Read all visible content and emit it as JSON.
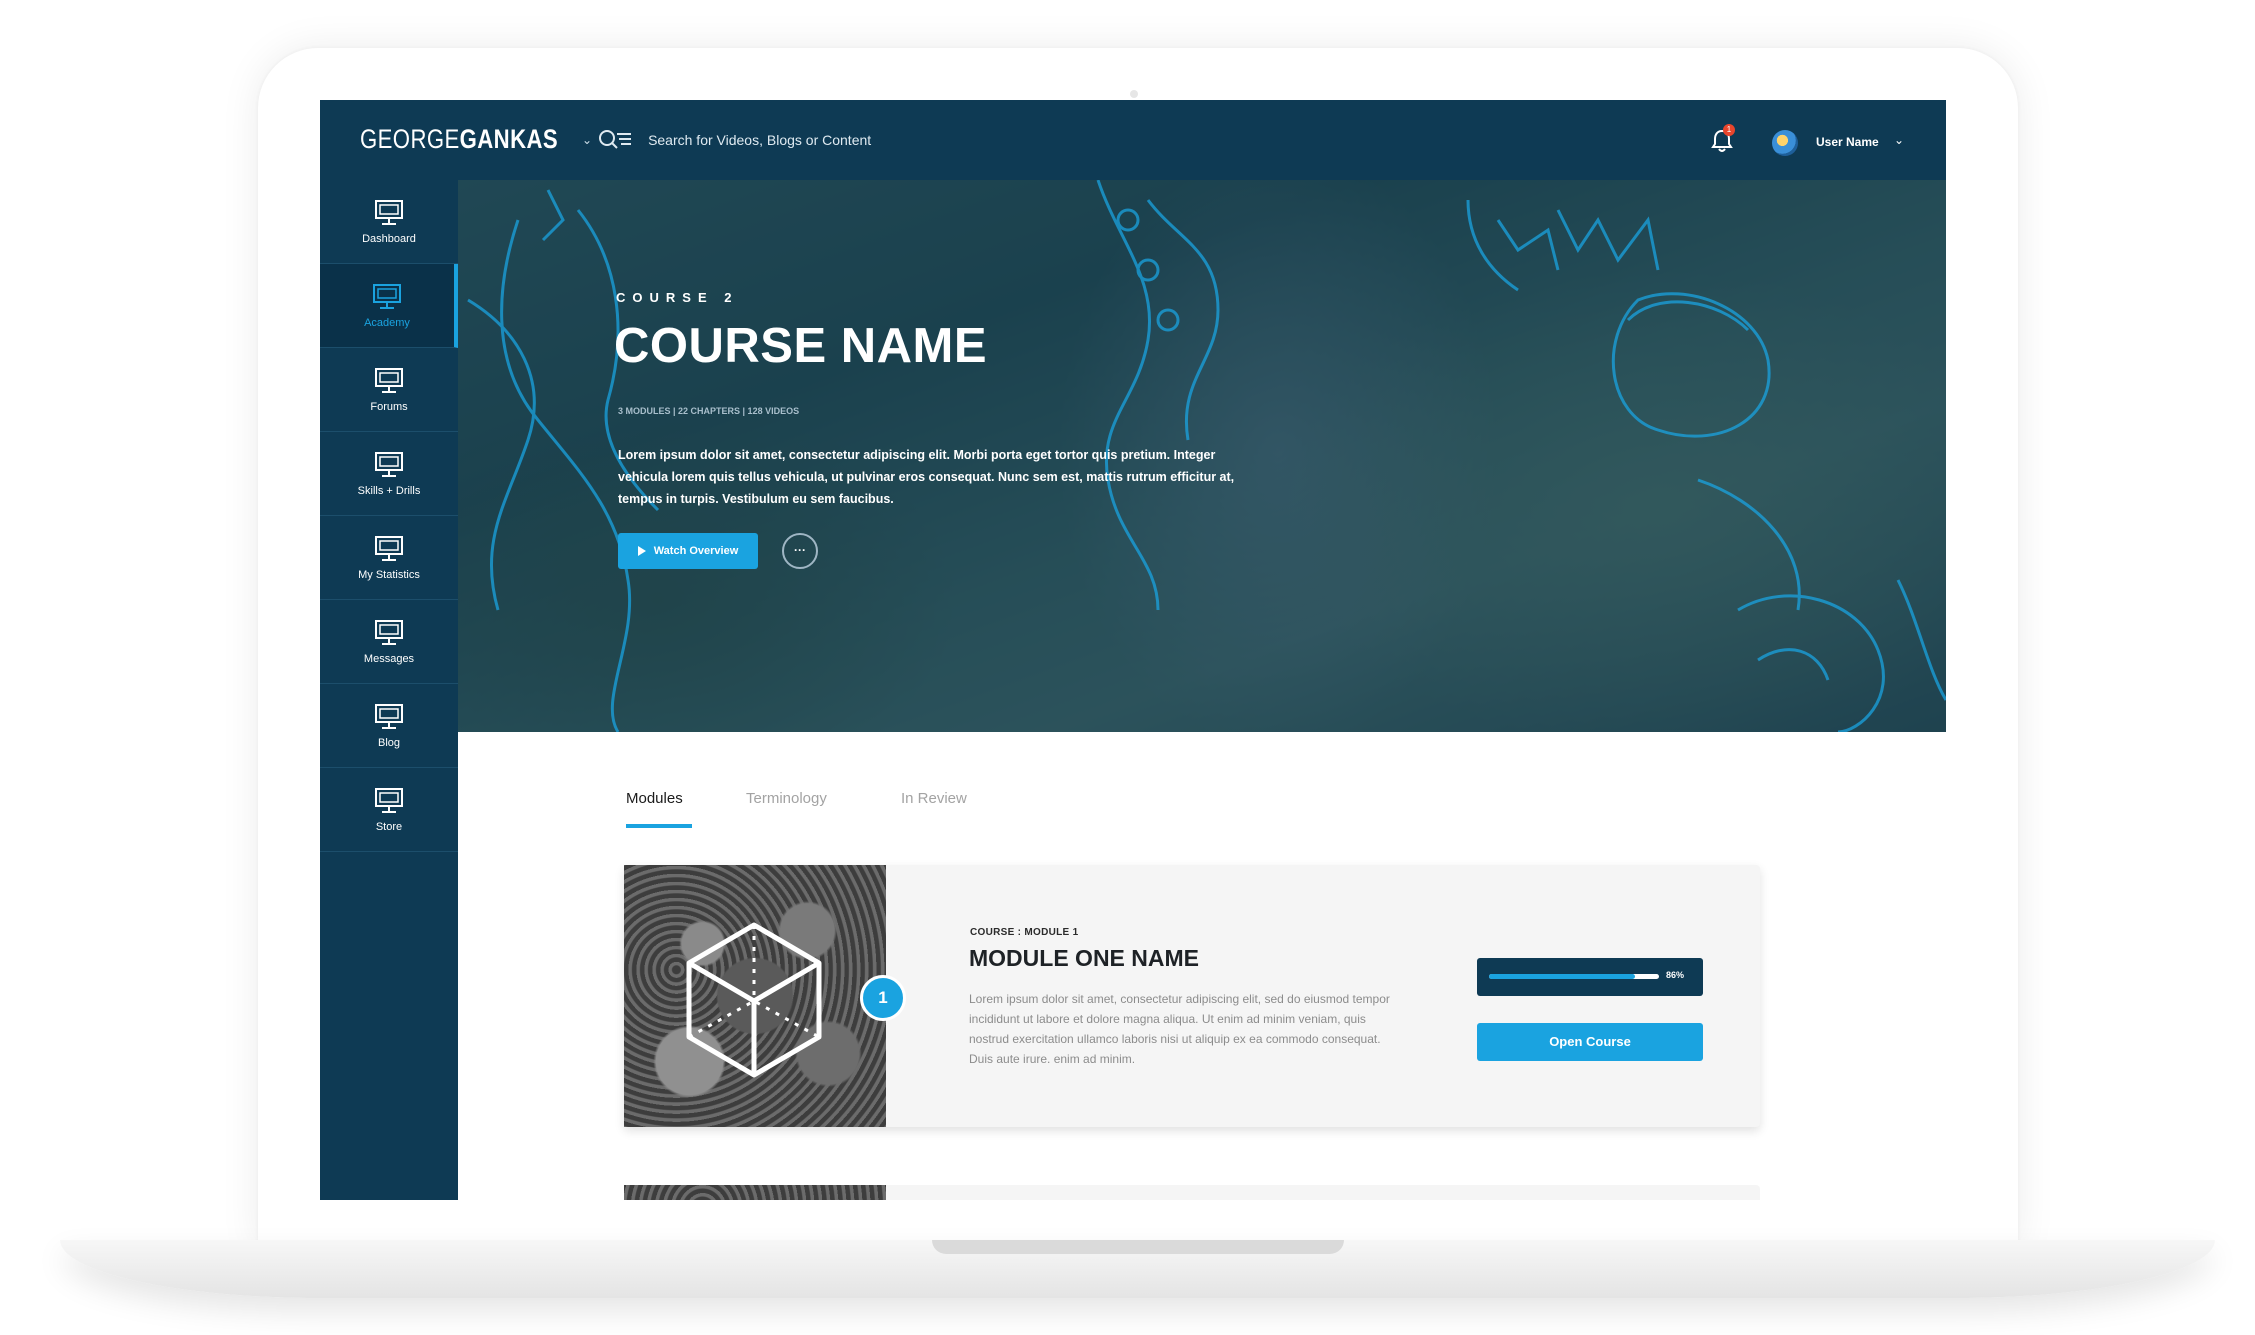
{
  "app": {
    "logo_light": "GEORGE",
    "logo_bold": "GANKAS"
  },
  "topbar": {
    "search_placeholder": "Search for Videos, Blogs or Content",
    "notifications_count": "1",
    "user_name": "User Name"
  },
  "sidebar": {
    "items": [
      {
        "label": "Dashboard",
        "icon": "monitor-icon",
        "active": false
      },
      {
        "label": "Academy",
        "icon": "monitor-icon",
        "active": true
      },
      {
        "label": "Forums",
        "icon": "monitor-icon",
        "active": false
      },
      {
        "label": "Skills + Drills",
        "icon": "monitor-icon",
        "active": false
      },
      {
        "label": "My Statistics",
        "icon": "monitor-icon",
        "active": false
      },
      {
        "label": "Messages",
        "icon": "monitor-icon",
        "active": false
      },
      {
        "label": "Blog",
        "icon": "monitor-icon",
        "active": false
      },
      {
        "label": "Store",
        "icon": "monitor-icon",
        "active": false
      }
    ]
  },
  "hero": {
    "kicker": "COURSE 2",
    "title": "COURSE NAME",
    "meta": "3 MODULES  |  22 CHAPTERS  |  128 VIDEOS",
    "description": "Lorem ipsum dolor sit amet, consectetur adipiscing elit. Morbi porta eget tortor quis pretium. Integer vehicula lorem quis tellus vehicula, ut pulvinar eros consequat. Nunc sem est, mattis rutrum efficitur at, tempus in turpis. Vestibulum eu sem faucibus.",
    "watch_label": "Watch Overview",
    "more_label": "···"
  },
  "tabs": [
    {
      "label": "Modules",
      "active": true
    },
    {
      "label": "Terminology",
      "active": false
    },
    {
      "label": "In Review",
      "active": false
    }
  ],
  "module": {
    "number": "1",
    "kicker": "COURSE : MODULE 1",
    "title": "MODULE ONE NAME",
    "description": "Lorem ipsum dolor sit amet, consectetur adipiscing elit, sed do eiusmod tempor incididunt ut labore et dolore magna aliqua. Ut enim ad minim veniam, quis nostrud exercitation ullamco laboris nisi ut aliquip ex ea commodo consequat. Duis aute irure.  enim ad minim.",
    "progress_percent": 86,
    "progress_label": "86%",
    "open_label": "Open Course"
  },
  "colors": {
    "navy": "#0e3a54",
    "accent": "#1aa3e0",
    "badge_red": "#e8452c"
  }
}
